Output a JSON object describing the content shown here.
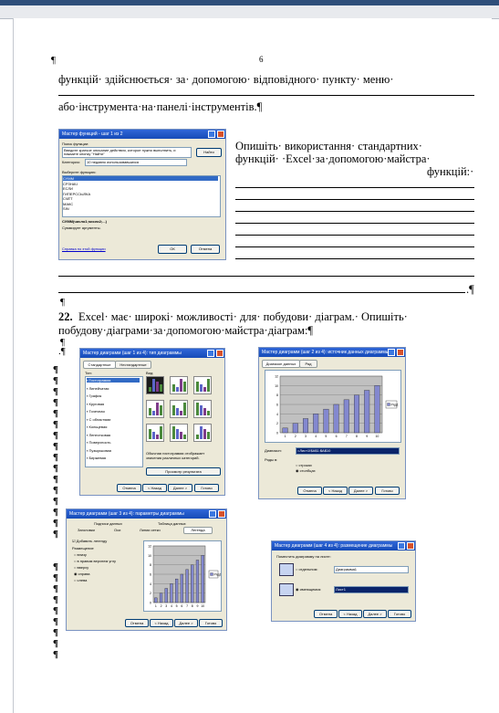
{
  "page": {
    "number": "6",
    "pilcrow": "¶",
    "line1": "функцій· здійснюється· за· допомогою· відповідного· пункту· меню·",
    "line2": "або·інструмента·на·панелі·інструментів.¶",
    "q_line1": "Опишіть· використання· стандартних·",
    "q_line2": "функцій· ·Excel·за·допомогою·майстра·",
    "q_line3": "функцій:·",
    "item_number": "22.",
    "item_line1": "Excel· має· широкі· можливості· для· побудови· діаграм.· Опишіть·",
    "item_line2": "побудову·діаграми·за·допомогою·майстра·діаграм:¶",
    "end_mark": ".¶",
    "dot_mark": ".¶"
  },
  "dialog_functions": {
    "title": "Мастер функций - шаг 1 из 2",
    "search_label": "Поиск функции:",
    "search_value": "Введите краткое описание действия, которое нужно выполнить, и нажмите кнопку \"Найти\"",
    "find_button": "Найти",
    "category_label": "Категория:",
    "category_value": "10 недавно использовавшихся",
    "list_label": "Выберите функцию:",
    "functions": [
      "СУММ",
      "СРЗНАЧ",
      "ЕСЛИ",
      "ГИПЕРССЫЛКА",
      "СЧЁТ",
      "МАКС",
      "SIN"
    ],
    "signature": "СУММ(число1;число2;...)",
    "description": "Суммирует аргументы.",
    "help_link": "Справка по этой функции",
    "ok_button": "ОК",
    "cancel_button": "Отмена"
  },
  "dialog_chart1": {
    "title": "Мастер диаграмм (шаг 1 из 4): тип диаграммы",
    "tab_standard": "Стандартные",
    "tab_custom": "Нестандартные",
    "type_label": "Тип:",
    "view_label": "Вид:",
    "types": [
      "Гистограмма",
      "Линейчатая",
      "График",
      "Круговая",
      "Точечная",
      "С областями",
      "Кольцевая",
      "Лепестковая",
      "Поверхность",
      "Пузырьковая",
      "Биржевая"
    ],
    "desc": "Обычная гистограмма отображает значения различных категорий.",
    "preview_button": "Просмотр результата",
    "cancel": "Отмена",
    "back": "< Назад",
    "next": "Далее >",
    "finish": "Готово"
  },
  "dialog_chart2": {
    "title": "Мастер диаграмм (шаг 2 из 4): источник данных диаграммы",
    "tab_range": "Диапазон данных",
    "tab_series": "Ряд",
    "legend": "Ряд1",
    "range_label": "Диапазон:",
    "range_value": "=Лист1!$A$1:$A$10",
    "rows_label": "Ряды в:",
    "opt_rows": "строках",
    "opt_cols": "столбцах",
    "cancel": "Отмена",
    "back": "< Назад",
    "next": "Далее >",
    "finish": "Готово"
  },
  "dialog_chart3": {
    "title": "Мастер диаграмм (шаг 3 из 4): параметры диаграммы",
    "tab_labels": "Подписи данных",
    "tab_table": "Таблица данных",
    "tab_titles": "Заголовки",
    "tab_axes": "Оси",
    "tab_grid": "Линии сетки",
    "tab_legend": "Легенда",
    "add_legend": "Добавить легенду",
    "placement": "Размещение",
    "options": [
      "внизу",
      "в правом верхнем углу",
      "вверху",
      "справа",
      "слева"
    ],
    "legend": "Ряд1",
    "cancel": "Отмена",
    "back": "< Назад",
    "next": "Далее >",
    "finish": "Готово"
  },
  "dialog_chart4": {
    "title": "Мастер диаграмм (шаг 4 из 4): размещение диаграммы",
    "place_label": "Поместить диаграмму на листе:",
    "opt_separate": "отдельном:",
    "separate_value": "Диаграмма1",
    "opt_existing": "имеющемся:",
    "existing_value": "Лист1",
    "cancel": "Отмена",
    "back": "< Назад",
    "next": "Далее >",
    "finish": "Готово"
  },
  "chart_data": {
    "type": "bar",
    "categories": [
      "1",
      "2",
      "3",
      "4",
      "5",
      "6",
      "7",
      "8",
      "9",
      "10"
    ],
    "series": [
      {
        "name": "Ряд1",
        "values": [
          1,
          2,
          3,
          4,
          5,
          6,
          7,
          8,
          9,
          10
        ]
      }
    ],
    "ylim": [
      0,
      12
    ],
    "legend": "right"
  }
}
